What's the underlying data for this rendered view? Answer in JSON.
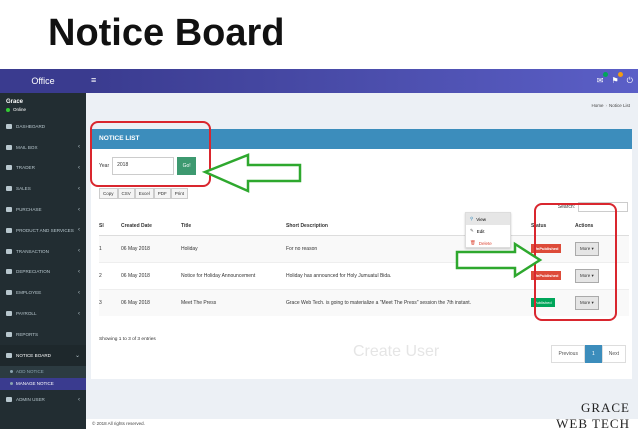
{
  "slide": {
    "title": "Notice Board"
  },
  "brand": "Office",
  "user": {
    "name": "Grace",
    "status": "Online"
  },
  "sidebar": {
    "items": [
      {
        "label": "DASHBOARD",
        "icon": "dashboard-icon",
        "chev": ""
      },
      {
        "label": "MAIL BOX",
        "icon": "mail-icon",
        "chev": "‹"
      },
      {
        "label": "TRADER",
        "icon": "trader-icon",
        "chev": "‹"
      },
      {
        "label": "SALES",
        "icon": "sales-icon",
        "chev": "‹"
      },
      {
        "label": "PURCHASE",
        "icon": "cart-icon",
        "chev": "‹"
      },
      {
        "label": "PRODUCT AND SERVICES",
        "icon": "product-icon",
        "chev": "‹"
      },
      {
        "label": "TRANSACTION",
        "icon": "transaction-icon",
        "chev": "‹"
      },
      {
        "label": "DEPRECIATION",
        "icon": "depreciation-icon",
        "chev": "‹"
      },
      {
        "label": "EMPLOYEE",
        "icon": "employee-icon",
        "chev": "‹"
      },
      {
        "label": "PAYROLL",
        "icon": "payroll-icon",
        "chev": "‹"
      },
      {
        "label": "REPORTS",
        "icon": "reports-icon",
        "chev": ""
      },
      {
        "label": "NOTICE BOARD",
        "icon": "notice-icon",
        "chev": "⌄"
      }
    ],
    "sub_items": [
      {
        "label": "ADD NOTICE"
      },
      {
        "label": "MANAGE NOTICE"
      }
    ],
    "last_item": {
      "label": "ADMIN USER",
      "chev": "‹"
    }
  },
  "breadcrumb": {
    "home": "Home",
    "current": "Notice List"
  },
  "panel": {
    "title": "NOTICE LIST"
  },
  "filter": {
    "year_label": "Year",
    "year_value": "2018",
    "go_label": "Go!"
  },
  "export_buttons": [
    "Copy",
    "CSV",
    "Excel",
    "PDF",
    "Print"
  ],
  "search_label": "Search:",
  "table": {
    "headers": [
      "Sl",
      "Created Date",
      "Title",
      "Short Description",
      "Status",
      "Actions"
    ],
    "rows": [
      {
        "sl": "1",
        "date": "06 May 2018",
        "title": "Holiday",
        "desc": "For no reason",
        "status": "UnPublished",
        "action": "More"
      },
      {
        "sl": "2",
        "date": "06 May 2018",
        "title": "Notice for Holiday Announcement",
        "desc": "Holiday has announced for Holy Jumuatul Bida.",
        "status": "UnPublished",
        "action": "More"
      },
      {
        "sl": "3",
        "date": "06 May 2018",
        "title": "Meet The Press",
        "desc": "Grace Web Tech. is going to materialize a \"Meet The Press\" session the 7th instant.",
        "status": "Published",
        "action": "More"
      }
    ]
  },
  "dropdown": {
    "view": "View",
    "edit": "Edit",
    "delete": "Delete"
  },
  "showing": "Showing 1 to 3 of 3 entries",
  "pager": {
    "prev": "Previous",
    "current": "1",
    "next": "Next"
  },
  "footer": "© 2018 All rights reserved.",
  "watermark": "Create User",
  "logo": {
    "line1": "GRACE",
    "line2": "WEB TECH"
  },
  "colors": {
    "primary": "#3a3b8f",
    "panel_header": "#3c8dbc",
    "go": "#3d9970",
    "annotation": "#d9262e",
    "arrow": "#2ea82e"
  }
}
